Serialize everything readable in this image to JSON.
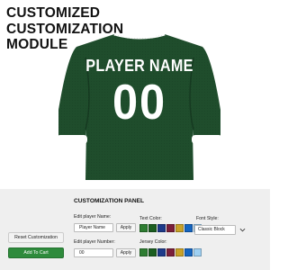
{
  "page": {
    "title_lines": [
      "CUSTOMIZED",
      "CUSTOMIZATION",
      "MODULE"
    ]
  },
  "jersey": {
    "player_name": "PLAYER NAME",
    "player_number": "00",
    "jersey_color": "#1f4d2c",
    "text_color": "#ffffff",
    "trim_color": "#ffffff"
  },
  "panel": {
    "title": "CUSTOMIZATION PANEL",
    "player_name_label": "Edit player Name:",
    "player_name_value": "Player Name",
    "player_number_label": "Edit player Number:",
    "player_number_value": "00",
    "apply_label": "Apply",
    "text_color_label": "Text Color:",
    "jersey_color_label": "Jersey Color:",
    "text_colors": [
      "#2e7d32",
      "#1b5e20",
      "#1e3a8a",
      "#7b1f3a",
      "#c9a227",
      "#1565c0",
      "#9fd0f2"
    ],
    "jersey_colors": [
      "#2e7d32",
      "#1b5e20",
      "#1e3a8a",
      "#7b1f3a",
      "#c9a227",
      "#1565c0",
      "#9fd0f2"
    ],
    "font_style_label": "Font Style:",
    "font_style_value": "Classic Block"
  },
  "actions": {
    "reset_label": "Reset Customization",
    "cart_label": "Add To Cart"
  }
}
